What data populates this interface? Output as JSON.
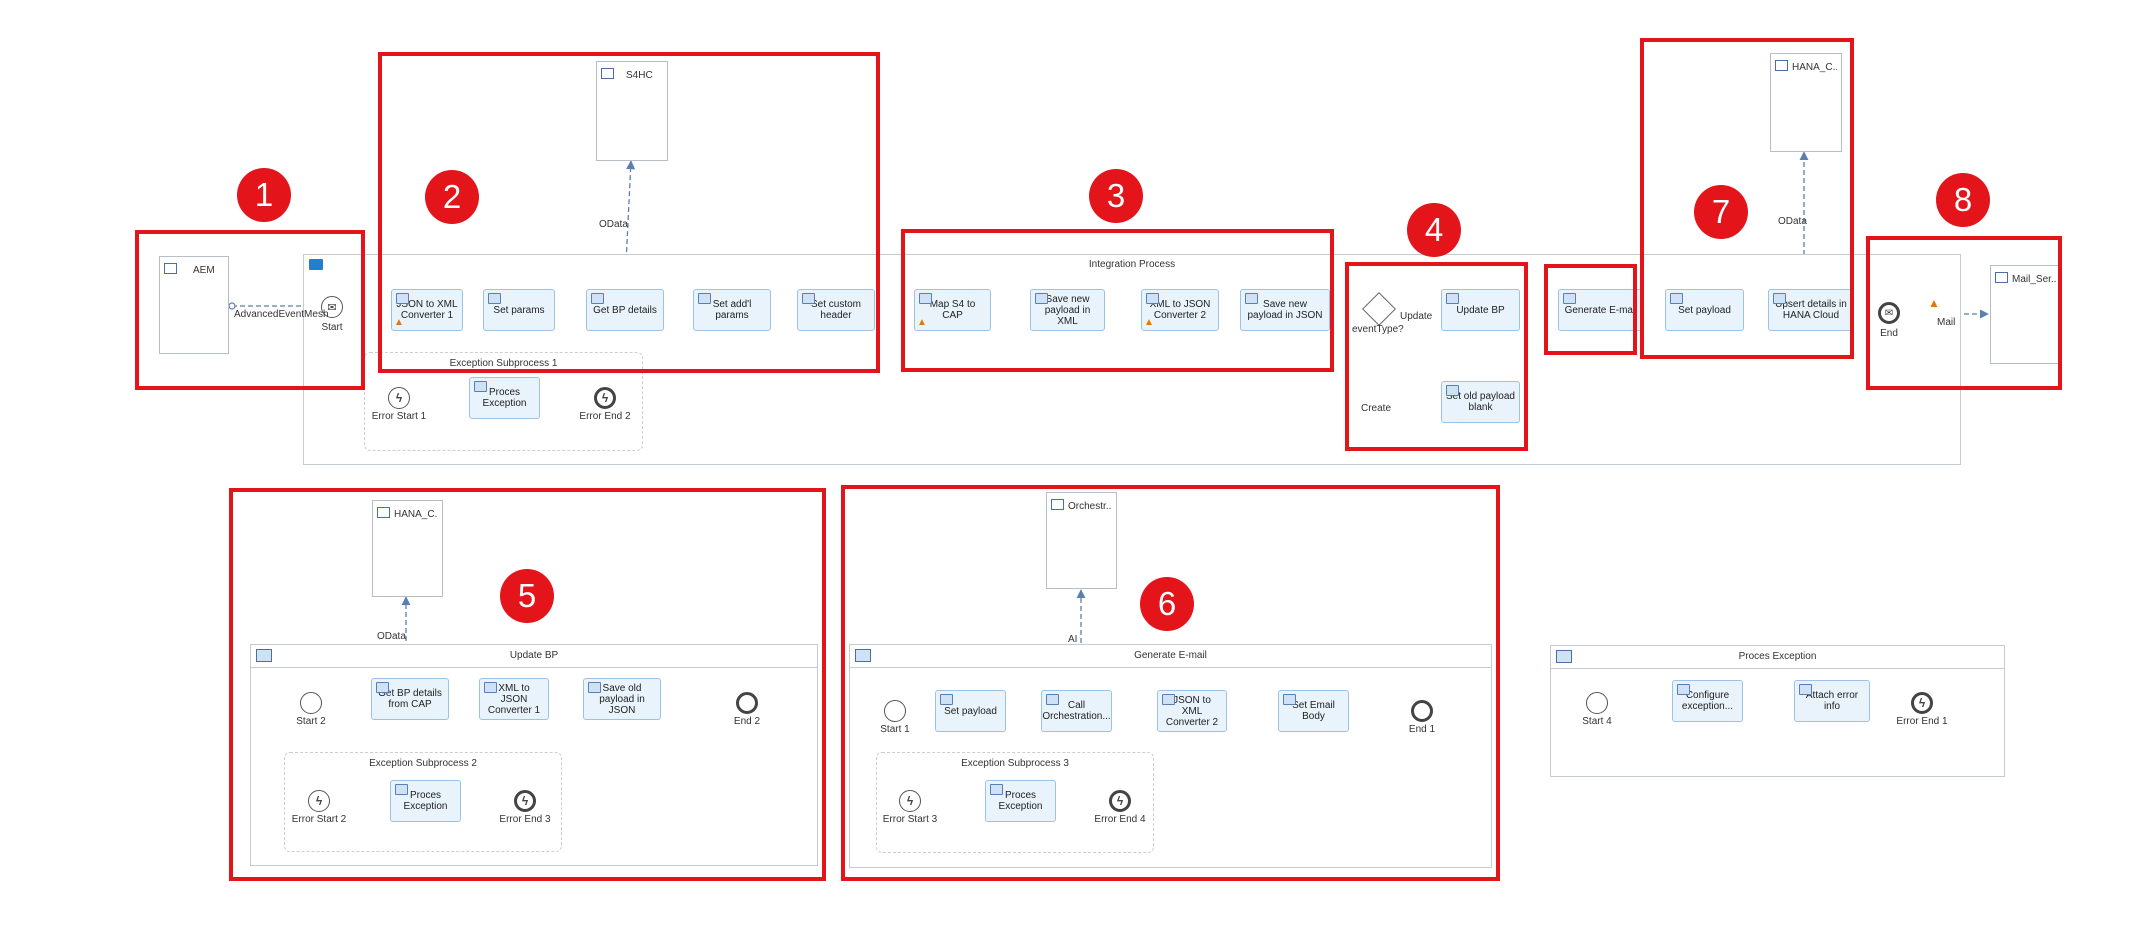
{
  "pools": {
    "integration_process": "Integration Process",
    "update_bp": "Update BP",
    "generate_email": "Generate E-mail",
    "proces_exception": "Proces Exception"
  },
  "subprocesses": {
    "sp1": "Exception Subprocess 1",
    "sp2": "Exception Subprocess 2",
    "sp3": "Exception Subprocess 3"
  },
  "participants": {
    "aem": "AEM",
    "s4hc": "S4HC",
    "hana_top": "HANA_C...",
    "mail": "Mail_Ser...",
    "hana_bottom": "HANA_C...",
    "orchestr": "Orchestr..."
  },
  "tasks": {
    "json_to_xml_1": "JSON to XML Converter 1",
    "set_params": "Set params",
    "get_bp_details": "Get BP details",
    "set_addl_params": "Set add'l params",
    "set_custom_header": "Set custom header",
    "map_s4_cap": "Map S4 to CAP",
    "save_new_payload_xml": "Save new payload in XML",
    "xml_to_json_2": "XML to JSON Converter 2",
    "save_new_payload_json": "Save new payload in JSON",
    "update_bp": "Update BP",
    "set_old_payload_blank": "Set old payload blank",
    "generate_email": "Generate E-mail",
    "set_payload_main": "Set payload",
    "upsert_hana": "Upsert details in HANA Cloud",
    "proces_exception_sp1": "Proces Exception",
    "get_bp_details_cap": "Get BP details from CAP",
    "xml_to_json_1": "XML to JSON Converter 1",
    "save_old_payload_json": "Save old payload in JSON",
    "proces_exception_sp2": "Proces Exception",
    "set_payload_ge": "Set payload",
    "call_orchestration": "Call Orchestration...",
    "json_to_xml_2": "JSON to XML Converter 2",
    "set_email_body": "Set Email Body",
    "proces_exception_sp3": "Proces Exception",
    "configure_exception": "Configure exception...",
    "attach_error_info": "Attach error info"
  },
  "events": {
    "start": "Start",
    "end": "End",
    "error_start_1": "Error Start 1",
    "error_end_2": "Error End 2",
    "start_2": "Start 2",
    "end_2": "End 2",
    "error_start_2": "Error Start 2",
    "error_end_3": "Error End 3",
    "start_1": "Start 1",
    "end_1": "End 1",
    "error_start_3": "Error Start 3",
    "error_end_4": "Error End 4",
    "start_4": "Start 4",
    "error_end_1": "Error End 1"
  },
  "gateway": {
    "label": "eventType?",
    "update": "Update",
    "create": "Create"
  },
  "flow_labels": {
    "advanced_event_mesh": "AdvancedEventMesh",
    "odata_s4": "OData",
    "odata_hana_top": "OData",
    "mail": "Mail",
    "odata_hana_bottom": "OData",
    "ai": "AI"
  },
  "badges": [
    "1",
    "2",
    "3",
    "4",
    "5",
    "6",
    "7",
    "8"
  ],
  "colors": {
    "highlight": "#e4141b",
    "task_fill": "#e9f3fb",
    "task_border": "#9cc2e5",
    "message_flow": "#5b7fae",
    "warning": "#e8720c"
  }
}
